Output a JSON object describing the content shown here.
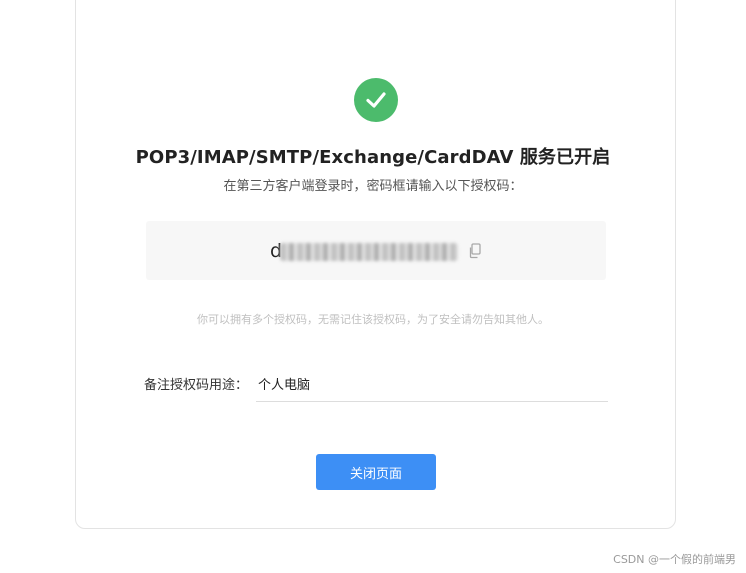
{
  "status": {
    "icon": "check-circle-icon",
    "color": "#4cbb6c"
  },
  "title": "POP3/IMAP/SMTP/Exchange/CardDAV 服务已开启",
  "subtitle": "在第三方客户端登录时，密码框请输入以下授权码：",
  "auth_code": {
    "visible_prefix": "d",
    "masked": true,
    "copy_icon": "copy-icon"
  },
  "tip": "你可以拥有多个授权码，无需记住该授权码，为了安全请勿告知其他人。",
  "remark": {
    "label": "备注授权码用途：",
    "value": "个人电脑"
  },
  "close_button_label": "关闭页面",
  "colors": {
    "primary": "#3d8ff5",
    "success": "#4cbb6c",
    "code_bg": "#f7f7f7"
  },
  "watermark": "CSDN @一个假的前端男"
}
